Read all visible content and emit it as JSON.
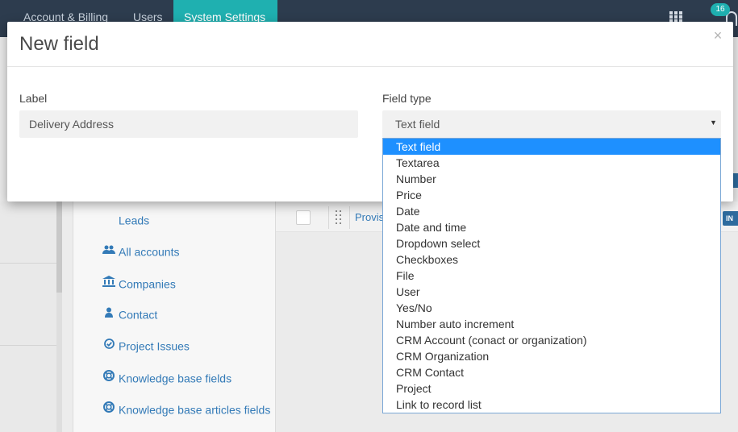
{
  "topnav": {
    "items": [
      {
        "label": "Account & Billing",
        "active": false
      },
      {
        "label": "Users",
        "active": false
      },
      {
        "label": "System Settings",
        "active": true
      }
    ],
    "notification_count": "16"
  },
  "sidebar_menu": {
    "items": [
      {
        "label": "Leads",
        "icon": "none"
      },
      {
        "label": "All accounts",
        "icon": "users-icon"
      },
      {
        "label": "Companies",
        "icon": "bank-icon"
      },
      {
        "label": "Contact",
        "icon": "user-icon"
      },
      {
        "label": "Project Issues",
        "icon": "check-circle-icon"
      },
      {
        "label": "Knowledge base fields",
        "icon": "life-ring-icon"
      },
      {
        "label": "Knowledge base articles fields",
        "icon": "life-ring-icon"
      }
    ]
  },
  "table": {
    "row_link": "Provis",
    "badge_label": "IN"
  },
  "modal": {
    "title": "New field",
    "close_glyph": "×",
    "label_field": {
      "label": "Label",
      "value": "Delivery Address"
    },
    "field_type": {
      "label": "Field type",
      "selected": "Text field",
      "options": [
        "Text field",
        "Textarea",
        "Number",
        "Price",
        "Date",
        "Date and time",
        "Dropdown select",
        "Checkboxes",
        "File",
        "User",
        "Yes/No",
        "Number auto increment",
        "CRM Account (conact or organization)",
        "CRM Organization",
        "CRM Contact",
        "Project",
        "Link to record list"
      ],
      "highlighted_index": 0
    }
  },
  "colors": {
    "topbar": "#2d3c4e",
    "active_tab": "#1fb0b0",
    "link": "#337ab7",
    "option_highlight": "#1e90ff"
  }
}
